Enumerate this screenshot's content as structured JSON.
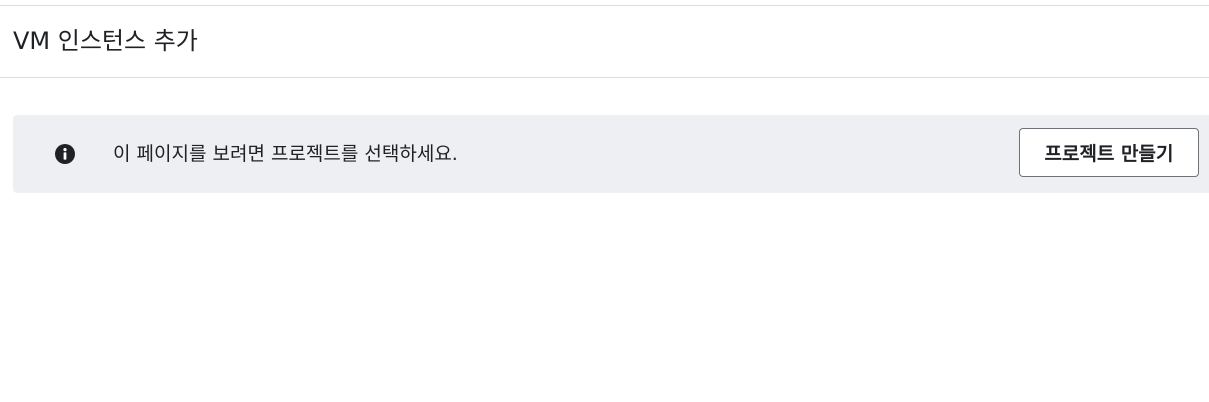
{
  "header": {
    "title": "VM 인스턴스 추가"
  },
  "banner": {
    "icon": "info-icon",
    "message": "이 페이지를 보려면 프로젝트를 선택하세요.",
    "button_label": "프로젝트 만들기"
  }
}
